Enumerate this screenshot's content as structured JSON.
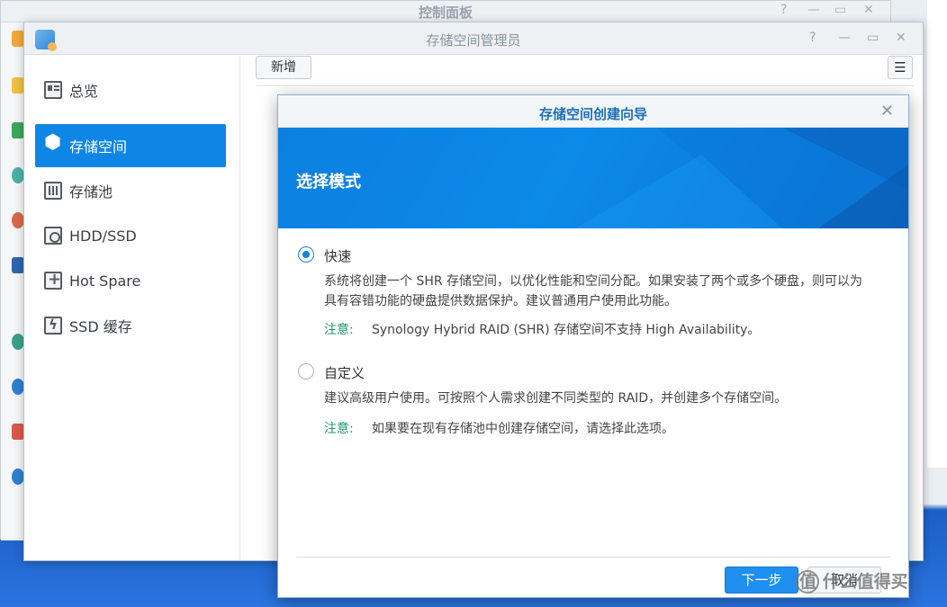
{
  "control_panel": {
    "title": "控制面板",
    "ctrl_help": "?",
    "ctrl_min": "—",
    "ctrl_max": "▭",
    "ctrl_close": "✕"
  },
  "storage_manager": {
    "title": "存储空间管理员",
    "ctrl_help": "?",
    "ctrl_min": "—",
    "ctrl_max": "▭",
    "ctrl_close": "✕",
    "nav": [
      {
        "label": "总览",
        "icon": "overview-icon"
      },
      {
        "label": "存储空间",
        "icon": "volume-icon",
        "active": true
      },
      {
        "label": "存储池",
        "icon": "storage-pool-icon"
      },
      {
        "label": "HDD/SSD",
        "icon": "hdd-icon"
      },
      {
        "label": "Hot Spare",
        "icon": "hot-spare-icon"
      },
      {
        "label": "SSD 缓存",
        "icon": "ssd-cache-icon"
      }
    ],
    "toolbar": {
      "add_label": "新增",
      "sort_icon": "sort-icon"
    }
  },
  "wizard": {
    "title": "存储空间创建向导",
    "close": "✕",
    "heading": "选择模式",
    "options": [
      {
        "label": "快速",
        "checked": true,
        "description": "系统将创建一个 SHR 存储空间，以优化性能和空间分配。如果安装了两个或多个硬盘，则可以为具有容错功能的硬盘提供数据保护。建议普通用户使用此功能。",
        "note_label": "注意:",
        "note_text": "Synology Hybrid RAID (SHR) 存储空间不支持 High Availability。"
      },
      {
        "label": "自定义",
        "checked": false,
        "description": "建议高级用户使用。可按照个人需求创建不同类型的 RAID，并创建多个存储空间。",
        "note_label": "注意:",
        "note_text": "如果要在现有存储池中创建存储空间，请选择此选项。"
      }
    ],
    "next_label": "下一步",
    "cancel_label": "取消"
  },
  "watermark": "值 什么值得买",
  "colors": {
    "accent": "#0f86e6",
    "banner": "#0a7fe0",
    "note": "#1d9a6a"
  }
}
